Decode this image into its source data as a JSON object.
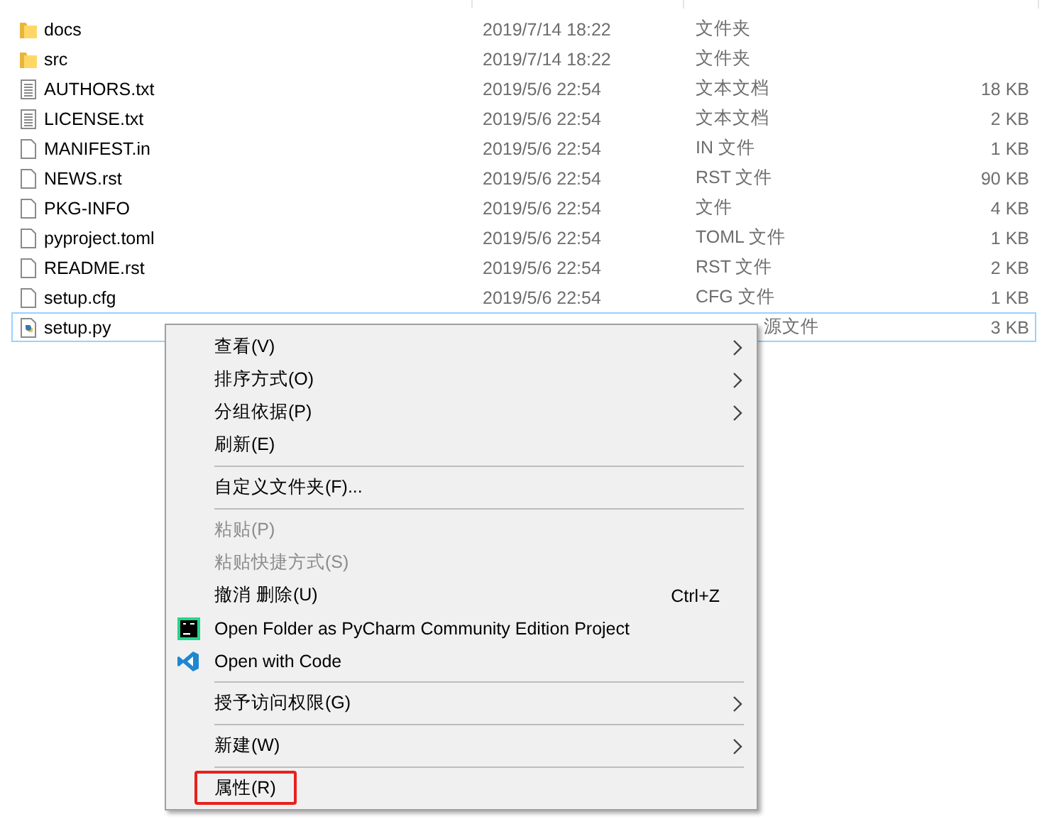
{
  "files": [
    {
      "name": "docs",
      "kind": "folder",
      "modified": "2019/7/14 18:22",
      "type": "文件夹",
      "selected": false
    },
    {
      "name": "src",
      "kind": "folder",
      "modified": "2019/7/14 18:22",
      "type": "文件夹",
      "selected": false
    },
    {
      "name": "AUTHORS.txt",
      "kind": "text",
      "modified": "2019/5/6 22:54",
      "type": "文本文档",
      "size": "18 KB",
      "selected": false
    },
    {
      "name": "LICENSE.txt",
      "kind": "text",
      "modified": "2019/5/6 22:54",
      "type": "文本文档",
      "size": "2 KB",
      "selected": false
    },
    {
      "name": "MANIFEST.in",
      "kind": "blank",
      "modified": "2019/5/6 22:54",
      "type": "IN 文件",
      "size": "1 KB",
      "selected": false
    },
    {
      "name": "NEWS.rst",
      "kind": "blank",
      "modified": "2019/5/6 22:54",
      "type": "RST 文件",
      "size": "90 KB",
      "selected": false
    },
    {
      "name": "PKG-INFO",
      "kind": "blank",
      "modified": "2019/5/6 22:54",
      "type": "文件",
      "size": "4 KB",
      "selected": false
    },
    {
      "name": "pyproject.toml",
      "kind": "blank",
      "modified": "2019/5/6 22:54",
      "type": "TOML 文件",
      "size": "1 KB",
      "selected": false
    },
    {
      "name": "README.rst",
      "kind": "blank",
      "modified": "2019/5/6 22:54",
      "type": "RST 文件",
      "size": "2 KB",
      "selected": false
    },
    {
      "name": "setup.cfg",
      "kind": "blank",
      "modified": "2019/5/6 22:54",
      "type": "CFG 文件",
      "size": "1 KB",
      "selected": false
    },
    {
      "name": "setup.py",
      "kind": "python",
      "type": "源文件",
      "size": "3 KB",
      "selected": true
    }
  ],
  "context_menu": [
    {
      "kind": "item",
      "label": "查看(V)",
      "submenu": true,
      "disabled": false
    },
    {
      "kind": "item",
      "label": "排序方式(O)",
      "submenu": true,
      "disabled": false
    },
    {
      "kind": "item",
      "label": "分组依据(P)",
      "submenu": true,
      "disabled": false
    },
    {
      "kind": "item",
      "label": "刷新(E)",
      "submenu": false,
      "disabled": false
    },
    {
      "kind": "separator"
    },
    {
      "kind": "item",
      "label": "自定义文件夹(F)...",
      "submenu": false,
      "disabled": false
    },
    {
      "kind": "separator"
    },
    {
      "kind": "item",
      "label": "粘贴(P)",
      "submenu": false,
      "disabled": true
    },
    {
      "kind": "item",
      "label": "粘贴快捷方式(S)",
      "submenu": false,
      "disabled": true
    },
    {
      "kind": "item",
      "label": "撤消 删除(U)",
      "submenu": false,
      "disabled": false,
      "shortcut": "Ctrl+Z"
    },
    {
      "kind": "pycharm",
      "label": "Open Folder as PyCharm Community Edition Project",
      "submenu": false,
      "disabled": false
    },
    {
      "kind": "vscode",
      "label": "Open with Code",
      "submenu": false,
      "disabled": false
    },
    {
      "kind": "separator"
    },
    {
      "kind": "item",
      "label": "授予访问权限(G)",
      "submenu": true,
      "disabled": false
    },
    {
      "kind": "separator"
    },
    {
      "kind": "item",
      "label": "新建(W)",
      "submenu": true,
      "disabled": false
    },
    {
      "kind": "separator"
    },
    {
      "kind": "item",
      "label": "属性(R)",
      "submenu": false,
      "disabled": false,
      "outlined": true
    }
  ]
}
